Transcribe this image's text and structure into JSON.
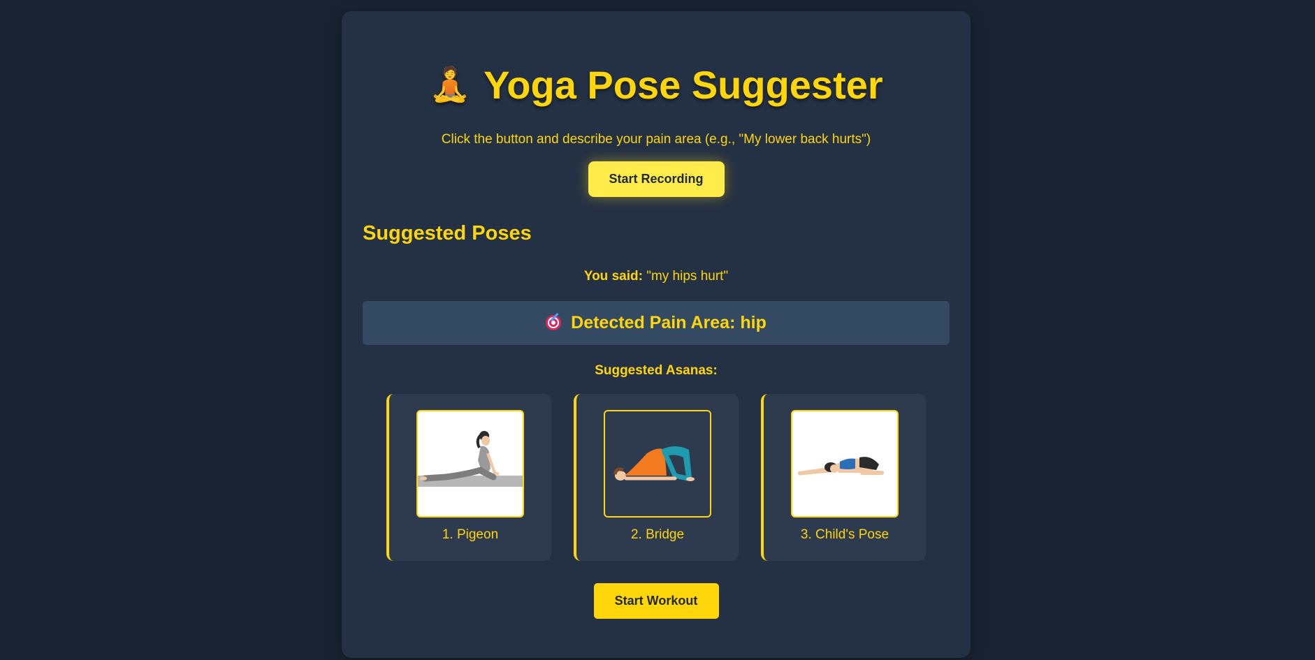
{
  "header": {
    "icon": "person-in-lotus-position-icon",
    "title": "Yoga Pose Suggester"
  },
  "instruction": "Click the button and describe your pain area (e.g., \"My lower back hurts\")",
  "record_button_label": "Start Recording",
  "suggestions": {
    "section_title": "Suggested Poses",
    "you_said_label": "You said:",
    "you_said_value": "\"my hips hurt\"",
    "detected_icon": "target-icon",
    "detected_text": "Detected Pain Area: hip",
    "asanas_label": "Suggested Asanas:",
    "poses": [
      {
        "name": "1. Pigeon",
        "image": "pigeon-pose-image"
      },
      {
        "name": "2. Bridge",
        "image": "bridge-pose-image"
      },
      {
        "name": "3. Child's Pose",
        "image": "childs-pose-image"
      }
    ]
  },
  "workout_button_label": "Start Workout",
  "colors": {
    "background": "#1a2332",
    "card": "#243044",
    "accent": "#ffd60a",
    "detected_box": "#344a63",
    "pose_card": "#2e3b4f"
  }
}
